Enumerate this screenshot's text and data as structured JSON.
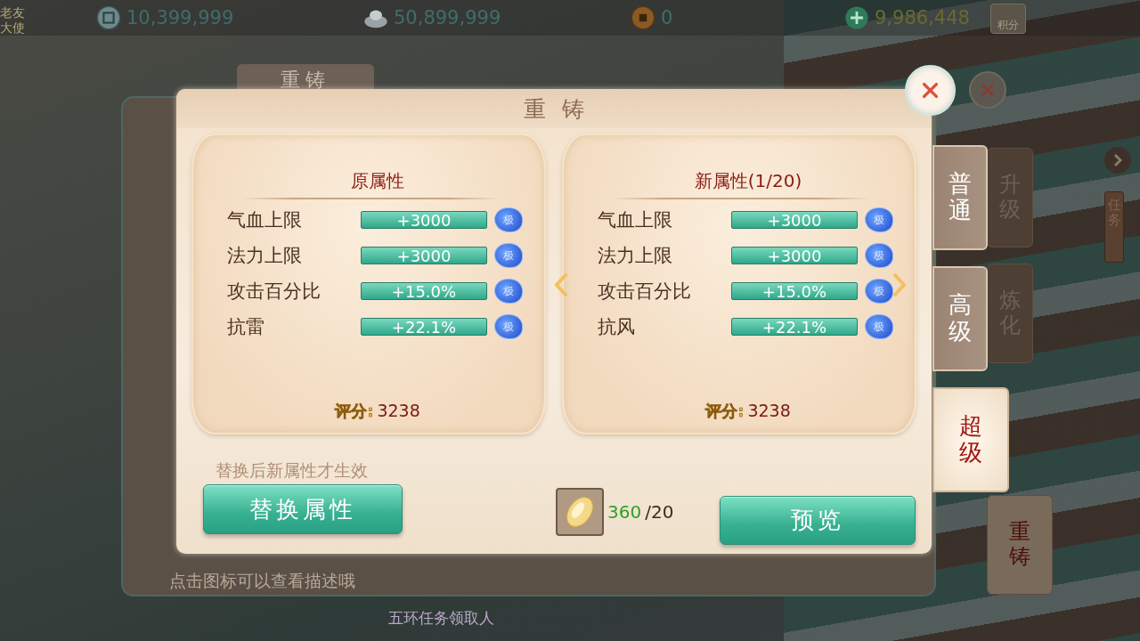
{
  "top_bar": {
    "npc_name": [
      "老友",
      "大使"
    ],
    "currencies": [
      {
        "kind": "coin",
        "amount": "10,399,999"
      },
      {
        "kind": "ingot",
        "amount": "50,899,999"
      },
      {
        "kind": "copper",
        "amount": "0"
      },
      {
        "kind": "jade",
        "amount": "9,986,448"
      }
    ],
    "points_button": "积分"
  },
  "background_panel": {
    "title": "重铸",
    "hint": "点击图标可以查看描述哦",
    "side_tabs": [
      {
        "label": "升级",
        "selected": false
      },
      {
        "label": "炼化",
        "selected": false
      },
      {
        "label": "重铸",
        "selected": true
      }
    ]
  },
  "task_button": "任务",
  "quest_label": "五环任务领取人",
  "dialog": {
    "title": "重铸",
    "panels": [
      {
        "title": "原属性",
        "attributes": [
          {
            "name": "气血上限",
            "value": "+3000",
            "grade": "极"
          },
          {
            "name": "法力上限",
            "value": "+3000",
            "grade": "极"
          },
          {
            "name": "攻击百分比",
            "value": "+15.0%",
            "grade": "极"
          },
          {
            "name": "抗雷",
            "value": "+22.1%",
            "grade": "极"
          }
        ],
        "score_label": "评分:",
        "score": "3238"
      },
      {
        "title": "新属性(1/20)",
        "attributes": [
          {
            "name": "气血上限",
            "value": "+3000",
            "grade": "极"
          },
          {
            "name": "法力上限",
            "value": "+3000",
            "grade": "极"
          },
          {
            "name": "攻击百分比",
            "value": "+15.0%",
            "grade": "极"
          },
          {
            "name": "抗风",
            "value": "+22.1%",
            "grade": "极"
          }
        ],
        "score_label": "评分:",
        "score": "3238"
      }
    ],
    "hint": "替换后新属性才生效",
    "replace_button": "替换属性",
    "material": {
      "owned": "360",
      "required": "/20"
    },
    "preview_button": "预览",
    "tabs": [
      {
        "label": "普通",
        "selected": false
      },
      {
        "label": "高级",
        "selected": false
      },
      {
        "label": "超级",
        "selected": true
      }
    ]
  }
}
